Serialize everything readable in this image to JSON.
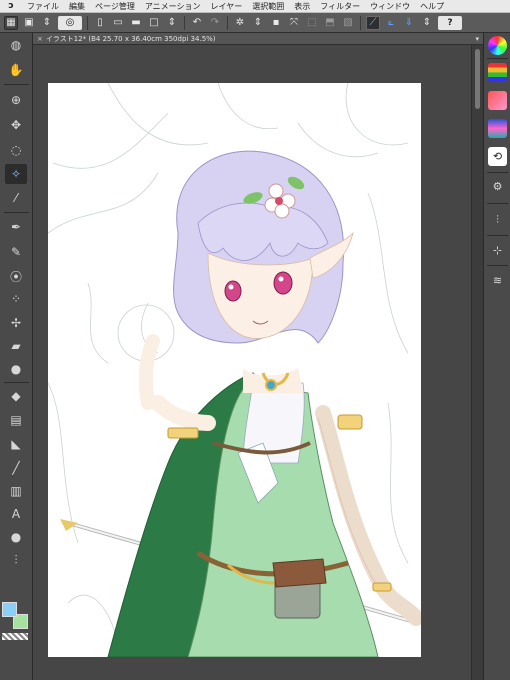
{
  "menu": {
    "items": [
      "ファイル",
      "編集",
      "ページ管理",
      "アニメーション",
      "レイヤー",
      "選択範囲",
      "表示",
      "フィルター",
      "ウィンドウ",
      "ヘルプ"
    ]
  },
  "tab": {
    "title": "イラスト12* (B4 25.70 x 36.40cm 350dpi 34.5%)",
    "close_glyph": "×",
    "menu_glyph": "▾"
  },
  "toolbar": {
    "help_label": "?"
  },
  "colors": {
    "main_color": "#8ad0f6",
    "sub_color": "#a6e1a0",
    "canvas_bg": "#ffffff",
    "workspace_bg": "#464646"
  },
  "left_tools": [
    "zoom-icon",
    "hand-icon",
    "zoom-tool-icon",
    "move-icon",
    "lasso-icon",
    "auto-select-icon",
    "eyedropper-icon",
    "pen-icon",
    "pencil-icon",
    "brush-icon",
    "airbrush-icon",
    "decoration-icon",
    "eraser-icon",
    "blend-icon",
    "fill-icon",
    "gradient-icon",
    "figure-icon",
    "ruler-icon",
    "frame-icon",
    "text-icon",
    "balloon-icon",
    "correct-line-icon"
  ],
  "right_tools": [
    "color-wheel-icon",
    "color-slider-icon",
    "color-set-icon",
    "intermediate-color-icon",
    "similar-color-icon",
    "tool-property-icon",
    "brush-size-icon",
    "navigator-icon",
    "layer-icon"
  ],
  "text_tool_glyph": "A"
}
